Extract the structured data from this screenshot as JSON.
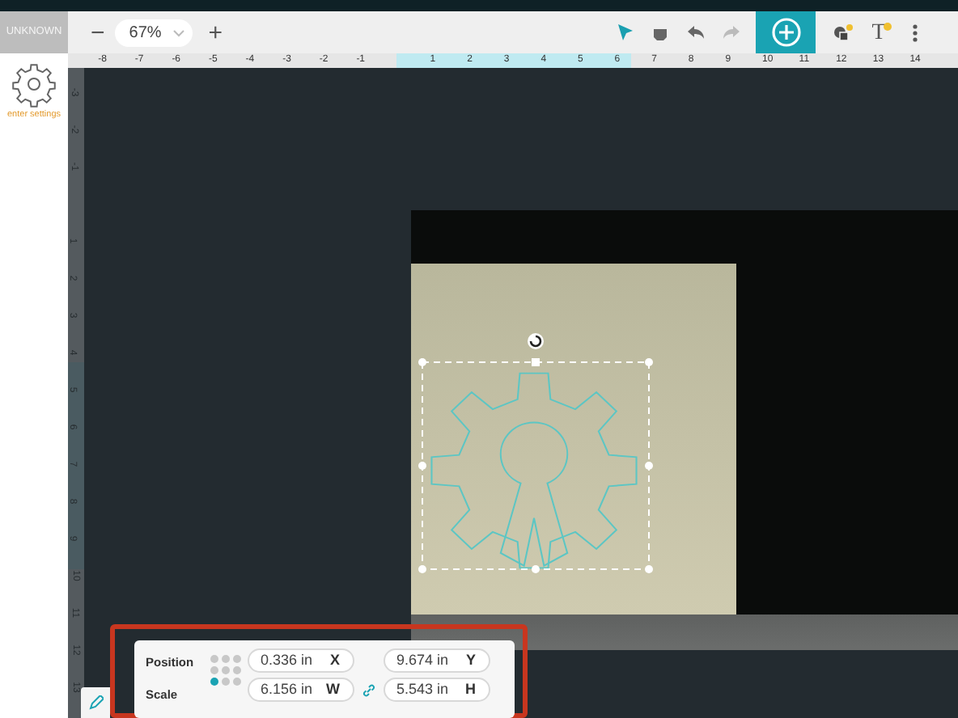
{
  "header": {
    "workspace": "UNKNOWN",
    "zoom_out": "−",
    "zoom": "67%",
    "zoom_in": "+"
  },
  "tools": [
    {
      "kind": "select",
      "selected": true
    },
    {
      "kind": "pan",
      "selected": false
    }
  ],
  "history": [
    {
      "kind": "undo",
      "disabled": false
    },
    {
      "kind": "redo",
      "disabled": true
    }
  ],
  "text_tool": {
    "glyph": "T"
  },
  "sidebar": {
    "label": "enter settings"
  },
  "ruler_h": [
    "-8",
    "-7",
    "-6",
    "-5",
    "-4",
    "-3",
    "-2",
    "-1",
    "1",
    "2",
    "3",
    "4",
    "5",
    "6",
    "7",
    "8",
    "9",
    "10",
    "11",
    "12",
    "13",
    "14"
  ],
  "ruler_v": [
    "-3",
    "-2",
    "-1",
    "1",
    "2",
    "3",
    "4",
    "5",
    "6",
    "7",
    "8",
    "9",
    "10",
    "11",
    "12",
    "13"
  ],
  "panel": {
    "anchor_points": [
      {
        "selected": false
      },
      {
        "selected": false
      },
      {
        "selected": false
      },
      {
        "selected": false
      },
      {
        "selected": false
      },
      {
        "selected": false
      },
      {
        "selected": true
      },
      {
        "selected": false
      },
      {
        "selected": false
      }
    ],
    "rows": [
      {
        "label": "Position",
        "fields": [
          {
            "value": "0.336 in",
            "axis": "X"
          },
          {
            "value": "9.674 in",
            "axis": "Y"
          }
        ]
      },
      {
        "label": "Scale",
        "lock_aspect": true,
        "fields": [
          {
            "value": "6.156 in",
            "axis": "W"
          },
          {
            "value": "5.543 in",
            "axis": "H"
          }
        ]
      }
    ]
  }
}
